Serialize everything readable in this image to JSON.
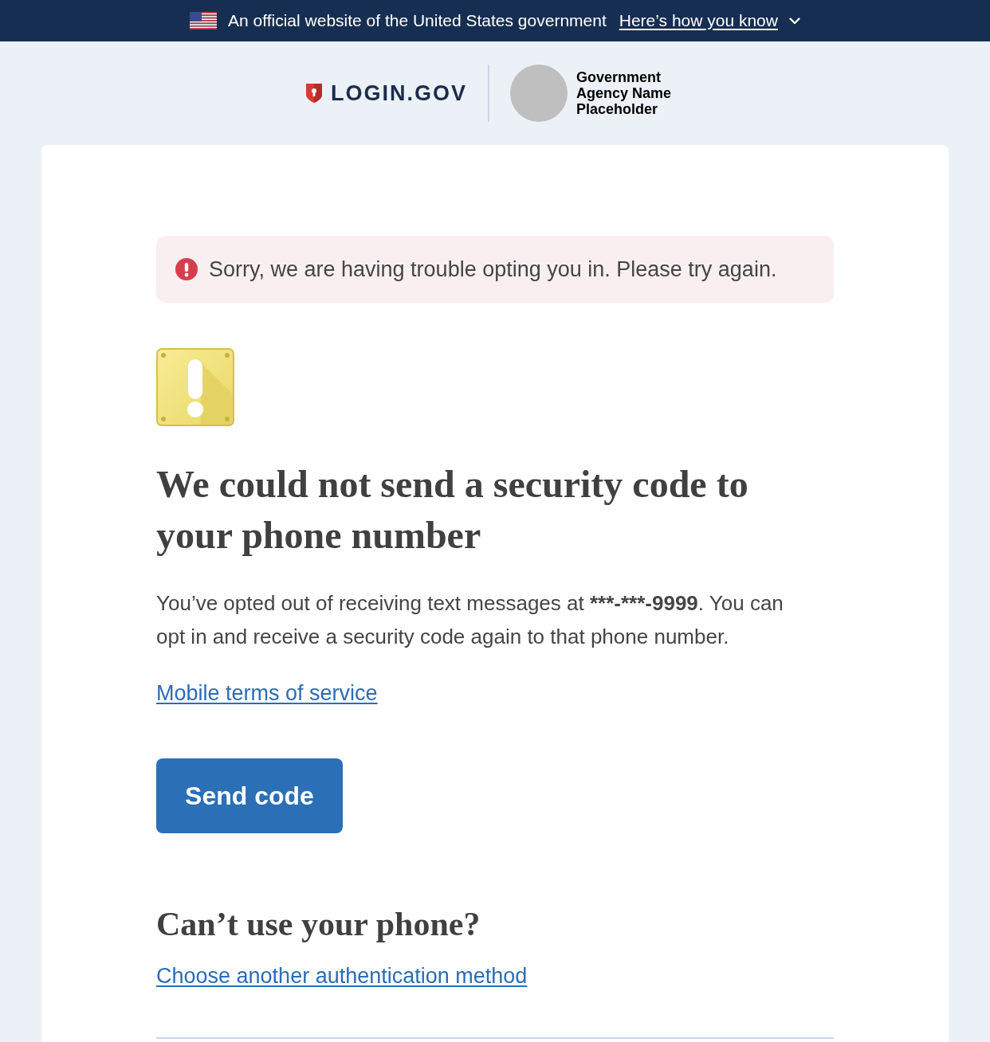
{
  "banner": {
    "text": "An official website of the United States government",
    "link": "Here’s how you know",
    "expanded": false
  },
  "header": {
    "logo": "LOGIN.GOV",
    "agency_name": "Government Agency Name Placeholder"
  },
  "alert": {
    "kind": "error",
    "message": "Sorry, we are having trouble opting you in. Please try again."
  },
  "main": {
    "heading": "We could not send a security code to your phone number",
    "body": {
      "before": "You’ve opted out of receiving text messages at ",
      "phone_number": "***-***-9999",
      "after": ". You can opt in and receive a security code again to that phone number."
    },
    "terms_link": "Mobile terms of service",
    "button": "Send code"
  },
  "alternative": {
    "heading": "Can’t use your phone?",
    "link": "Choose another authentication method"
  }
}
